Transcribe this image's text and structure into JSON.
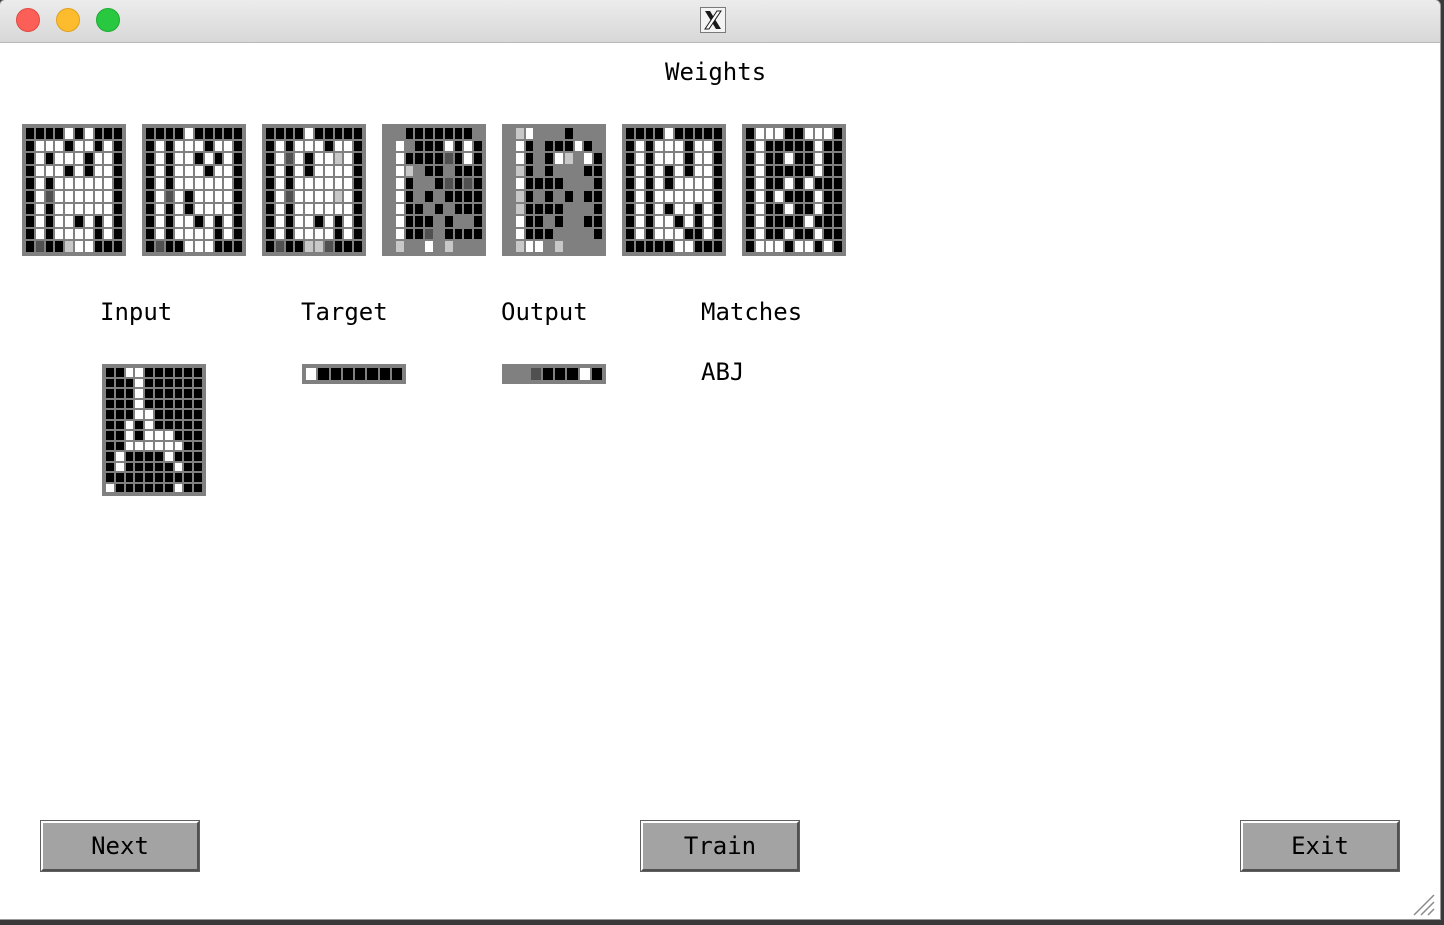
{
  "titlebar": {
    "icon": "x11-icon"
  },
  "weights": {
    "heading": "Weights",
    "grids": [
      [
        "bbbbwbwbbb",
        "bwwwbwwbwb",
        "bwbwwwbwwb",
        "bwwwbwbwwb",
        "bwbwwwwwwb",
        "bwdwwwwwwb",
        "bwbwwwwwwb",
        "bwbwwbwbwb",
        "bwbwwwwbwb",
        "bdbblwwbbb"
      ],
      [
        "bbbbwbbbbb",
        "bwbwwwbwwb",
        "bwbwwbwbwb",
        "bwbwwwbwwb",
        "bwbwwwwwwb",
        "bwdwbwwwwb",
        "bwbwbwwwwb",
        "bwbwwbwbwb",
        "bwbwwwwbwb",
        "bdbbwwwbbb"
      ],
      [
        "bbbbwbbbbb",
        "bwbwwwbwwb",
        "bwdwbwwlwb",
        "bwbwbwwwwb",
        "bwbwwwwwwb",
        "bwdwwwwlwb",
        "bwbwwwwwwb",
        "bwbwwbwbwb",
        "bwbwwwwbwb",
        "bdbblldbbb"
      ],
      [
        "ggbbbbbbbg",
        "gwgbbbwbwb",
        "gwbbbbdbwb",
        "gwlgbbgbbb",
        "gwbggbdbdb",
        "gwbgbgbbbb",
        "gwbbgbgbbb",
        "gwbbbgbggb",
        "gwbbdgbbbb",
        "glggwglggg"
      ],
      [
        "glwgggbggg",
        "gwbgbbbwbg",
        "gwbgbwlgwb",
        "glbgbgggbb",
        "gwbbbbgggb",
        "glbgbgbgbb",
        "glbbbbgggb",
        "gwbbgbggbb",
        "gwbbbggggb",
        "glwwglgggg"
      ],
      [
        "bbbbwbbbbb",
        "bwbwwwbwwb",
        "bwbwwwbwwb",
        "bwbwbwbwwb",
        "bwbwbwwwwb",
        "bwbwwwwwwb",
        "bwbwbwwbwb",
        "bwbwwbwbwb",
        "bwbwwwbbwb",
        "bbbbbwwbbb"
      ],
      [
        "bwwwbbwwwb",
        "bwbbbbbwbb",
        "bwbbwbbwbb",
        "bwbbbbbwbb",
        "bwbbwbwbbb",
        "bwbwbbbwbb",
        "bwbbwbbwbb",
        "bwbbbbwbbb",
        "bwbbwbbwbb",
        "bwwwbwwbwb"
      ]
    ]
  },
  "input": {
    "heading": "Input",
    "grid": [
      "bbwwbbbbbb",
      "bbbwbbbbbb",
      "bbbwbbbbbb",
      "bbbwbbbbbb",
      "bbbwwbbbbb",
      "bbwbwbbbbb",
      "bbwbwwwbbb",
      "bbwwwwwwbb",
      "bwbbbbwbbb",
      "bwbbbbbwbb",
      "bbbbbbbbbb",
      "wbbbbbbwbb"
    ]
  },
  "target": {
    "heading": "Target",
    "cells": "wbbbbbbb"
  },
  "output": {
    "heading": "Output",
    "cells": "ggdbbbwb"
  },
  "matches": {
    "heading": "Matches",
    "value": "ABJ"
  },
  "buttons": {
    "next_label": "Next",
    "train_label": "Train",
    "exit_label": "Exit"
  },
  "colors": {
    "b": "#000000",
    "w": "#ffffff",
    "g": "#808080",
    "d": "#505050",
    "l": "#c8c8c8"
  }
}
